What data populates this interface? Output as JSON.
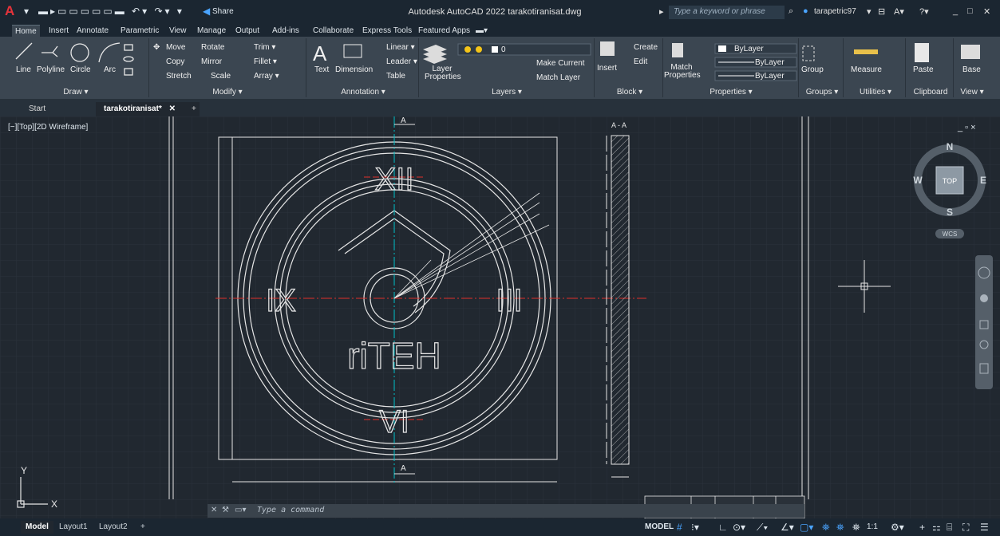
{
  "titlebar": {
    "app_title": "Autodesk AutoCAD 2022   tarakotiranisat.dwg",
    "share_label": "Share",
    "search_placeholder": "Type a keyword or phrase",
    "username": "tarapetric97"
  },
  "ribbon_tabs": [
    "Home",
    "Insert",
    "Annotate",
    "Parametric",
    "View",
    "Manage",
    "Output",
    "Add-ins",
    "Collaborate",
    "Express Tools",
    "Featured Apps"
  ],
  "ribbon": {
    "draw": {
      "title": "Draw ▾",
      "items": [
        "Line",
        "Polyline",
        "Circle",
        "Arc"
      ]
    },
    "modify": {
      "title": "Modify ▾",
      "items": [
        "Move",
        "Rotate",
        "Trim ▾",
        "Copy",
        "Mirror",
        "Fillet ▾",
        "Stretch",
        "Scale",
        "Array ▾"
      ]
    },
    "annotation": {
      "title": "Annotation ▾",
      "items": [
        "Text",
        "Dimension",
        "Linear ▾",
        "Leader ▾",
        "Table"
      ]
    },
    "layers": {
      "title": "Layers ▾",
      "items": [
        "Layer Properties",
        "Make Current",
        "Match Layer"
      ],
      "current_layer": "0"
    },
    "block": {
      "title": "Block ▾",
      "items": [
        "Insert",
        "Create",
        "Edit"
      ]
    },
    "properties": {
      "title": "Properties ▾",
      "items": [
        "Match Properties",
        "ByLayer",
        "ByLayer",
        "ByLayer"
      ]
    },
    "groups": {
      "title": "Groups ▾",
      "items": [
        "Group"
      ]
    },
    "utilities": {
      "title": "Utilities ▾",
      "items": [
        "Measure"
      ]
    },
    "clipboard": {
      "title": "Clipboard",
      "items": [
        "Paste"
      ]
    },
    "view": {
      "title": "View ▾",
      "items": [
        "Base"
      ]
    }
  },
  "doc_tabs": {
    "start": "Start",
    "active": "tarakotiranisat*"
  },
  "viewport": {
    "label": "[−][Top][2D Wireframe]",
    "section_label": "A - A",
    "cut_label": "A",
    "logo_text": "riTEH",
    "numerals": {
      "top": "XII",
      "left": "IX",
      "right": "III",
      "bottom": "VI"
    },
    "viewcube": {
      "top": "TOP",
      "n": "N",
      "s": "S",
      "e": "E",
      "w": "W",
      "wcs": "WCS"
    },
    "ucs": {
      "x": "X",
      "y": "Y"
    },
    "window_controls": "_ ▫ ×"
  },
  "command_line": {
    "placeholder": "Type a command"
  },
  "status": {
    "layouts": [
      "Model",
      "Layout1",
      "Layout2"
    ],
    "model_label": "MODEL",
    "scale": "1:1"
  },
  "colors": {
    "accent": "#0696d7",
    "canvas": "#212830",
    "ribbon": "#3b4651",
    "titlebar": "#1b2631",
    "red_axis": "#e0302a",
    "cyan_axis": "#00c0c8"
  }
}
